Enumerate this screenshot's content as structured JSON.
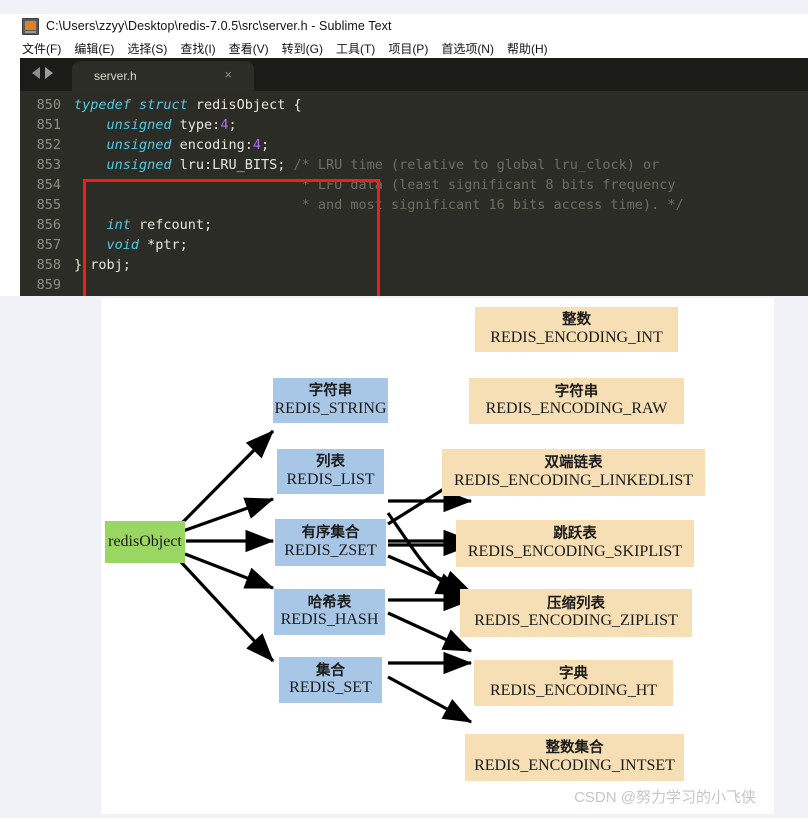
{
  "window": {
    "title": "C:\\Users\\zzyy\\Desktop\\redis-7.0.5\\src\\server.h - Sublime Text",
    "app_icon": "sublime-text-icon",
    "menu": [
      {
        "label": "文件(F)"
      },
      {
        "label": "编辑(E)"
      },
      {
        "label": "选择(S)"
      },
      {
        "label": "查找(I)"
      },
      {
        "label": "查看(V)"
      },
      {
        "label": "转到(G)"
      },
      {
        "label": "工具(T)"
      },
      {
        "label": "项目(P)"
      },
      {
        "label": "首选项(N)"
      },
      {
        "label": "帮助(H)"
      }
    ],
    "tab": {
      "label": "server.h",
      "close": "×"
    },
    "nav": {
      "back": "back-arrow",
      "forward": "forward-arrow"
    }
  },
  "editor": {
    "line_numbers": [
      "850",
      "851",
      "852",
      "853",
      "854",
      "855",
      "856",
      "857",
      "858",
      "859"
    ],
    "lines": [
      "typedef struct redisObject {",
      "    unsigned type:4;",
      "    unsigned encoding:4;",
      "    unsigned lru:LRU_BITS; /* LRU time (relative to global lru_clock) or",
      "                            * LFU data (least significant 8 bits frequency",
      "                            * and most significant 16 bits access time). */",
      "    int refcount;",
      "    void *ptr;",
      "} robj;",
      ""
    ],
    "highlight_color": "#f41b18"
  },
  "diagram": {
    "root": {
      "cn": "",
      "en": "redisObject"
    },
    "types": [
      {
        "cn": "字符串",
        "en": "REDIS_STRING"
      },
      {
        "cn": "列表",
        "en": "REDIS_LIST"
      },
      {
        "cn": "有序集合",
        "en": "REDIS_ZSET"
      },
      {
        "cn": "哈希表",
        "en": "REDIS_HASH"
      },
      {
        "cn": "集合",
        "en": "REDIS_SET"
      }
    ],
    "encodings": [
      {
        "cn": "整数",
        "en": "REDIS_ENCODING_INT"
      },
      {
        "cn": "字符串",
        "en": "REDIS_ENCODING_RAW"
      },
      {
        "cn": "双端链表",
        "en": "REDIS_ENCODING_LINKEDLIST"
      },
      {
        "cn": "跳跃表",
        "en": "REDIS_ENCODING_SKIPLIST"
      },
      {
        "cn": "压缩列表",
        "en": "REDIS_ENCODING_ZIPLIST"
      },
      {
        "cn": "字典",
        "en": "REDIS_ENCODING_HT"
      },
      {
        "cn": "整数集合",
        "en": "REDIS_ENCODING_INTSET"
      }
    ],
    "colors": {
      "root": "#9ad662",
      "type": "#a8c6e6",
      "encoding": "#f7dfb5"
    },
    "watermark": "CSDN @努力学习的小飞侠"
  }
}
